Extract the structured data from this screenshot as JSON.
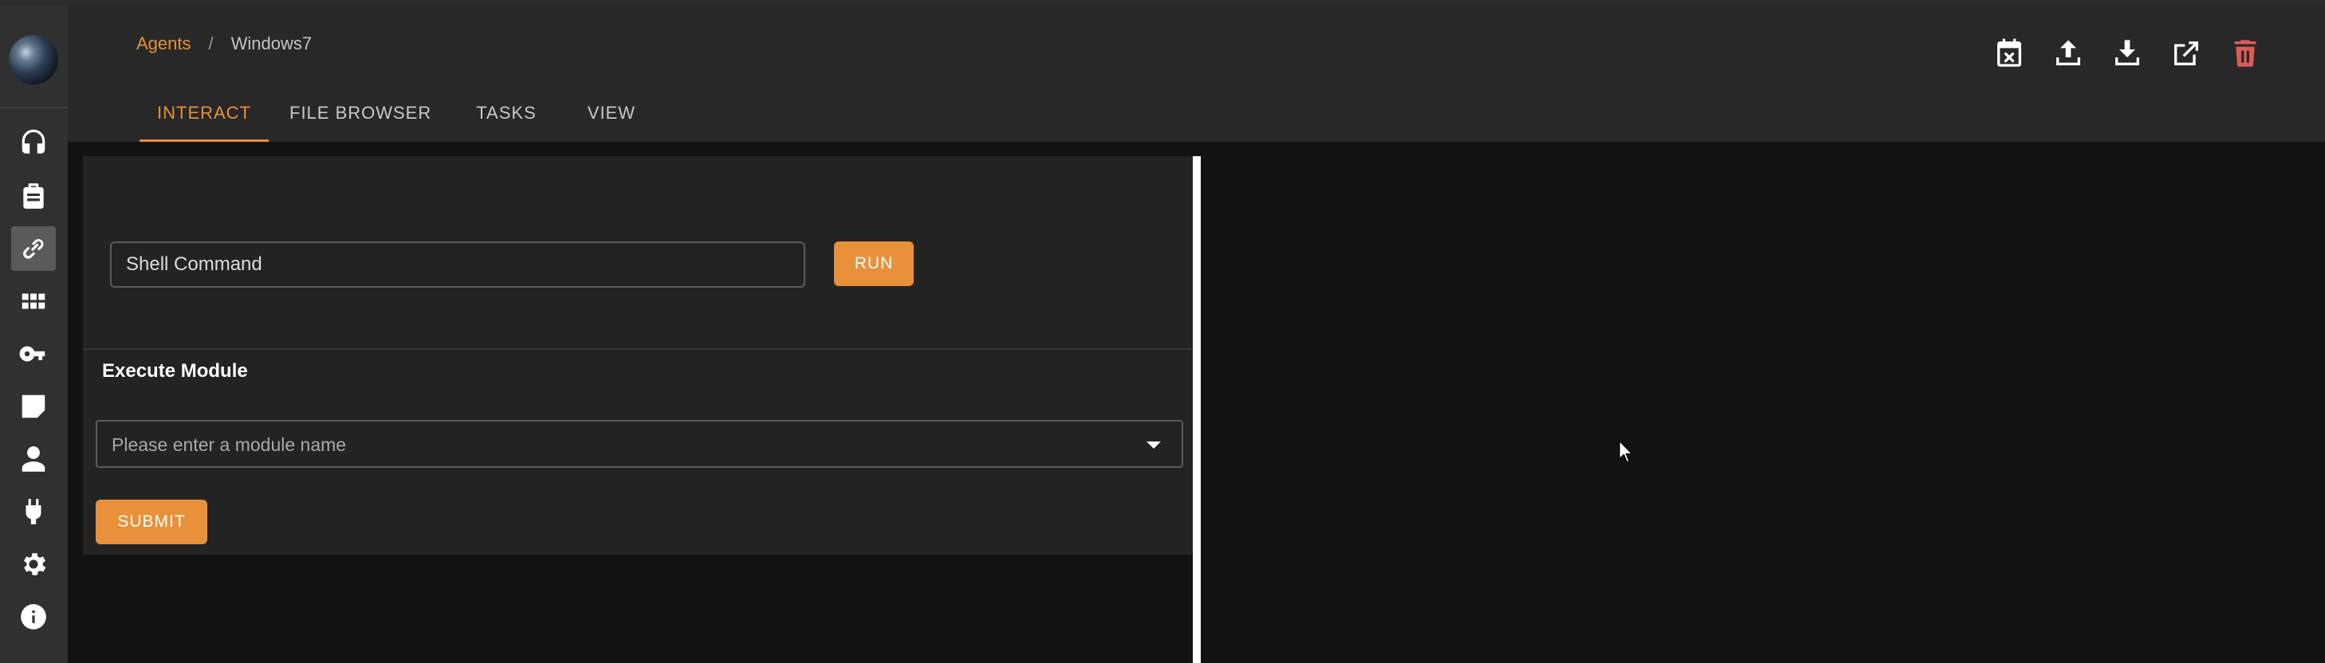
{
  "breadcrumb": {
    "parent": "Agents",
    "separator": "/",
    "current": "Windows7"
  },
  "tabs": [
    {
      "label": "INTERACT",
      "active": true
    },
    {
      "label": "FILE BROWSER",
      "active": false
    },
    {
      "label": "TASKS",
      "active": false
    },
    {
      "label": "VIEW",
      "active": false
    }
  ],
  "toolbar_icons": [
    "calendar-remove-icon",
    "upload-icon",
    "download-icon",
    "open-external-icon",
    "delete-icon"
  ],
  "sidebar_icons": [
    "headphones-icon",
    "briefcase-icon",
    "link-icon",
    "apps-grid-icon",
    "key-icon",
    "note-icon",
    "user-icon",
    "plug-icon",
    "gear-icon",
    "info-icon"
  ],
  "sidebar_active": "link-icon",
  "shell": {
    "placeholder": "Shell Command",
    "run_label": "RUN"
  },
  "execute_module": {
    "title": "Execute Module",
    "placeholder": "Please enter a module name",
    "submit_label": "SUBMIT"
  },
  "colors": {
    "accent": "#e8913a",
    "delete": "#e05a57",
    "header_bg": "#282828",
    "rail_bg": "#303030",
    "panel_bg": "#232323",
    "page_bg": "#121212"
  }
}
